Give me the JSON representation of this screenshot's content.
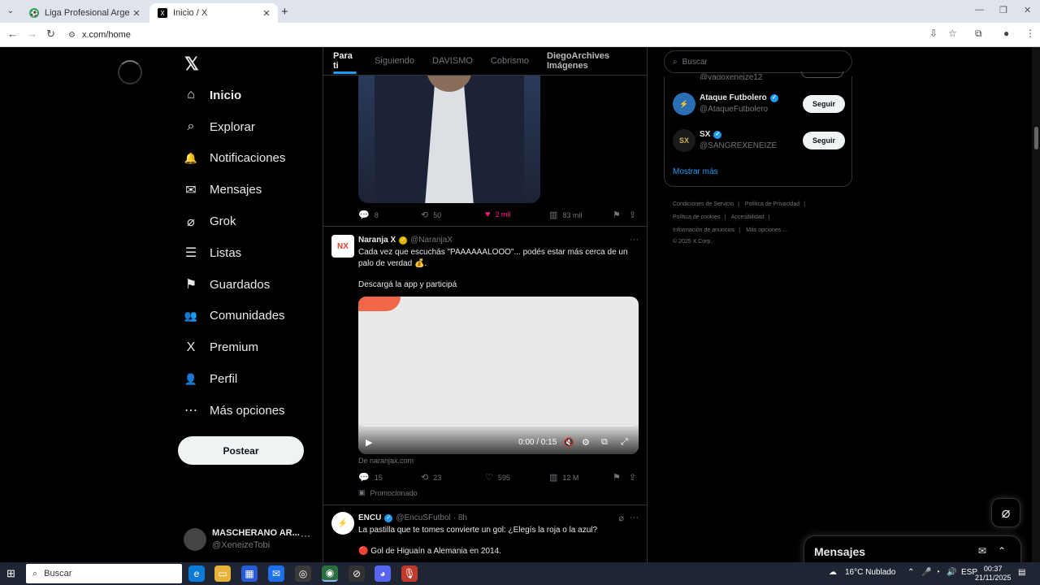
{
  "browser": {
    "tabs": [
      {
        "title": "Liga Profesional Argentina - PO",
        "active": false
      },
      {
        "title": "Inicio / X",
        "active": true
      }
    ],
    "url": "x.com/home"
  },
  "sidebar": {
    "items": [
      {
        "label": "Inicio",
        "icon": "home-icon",
        "glyph": "⌂"
      },
      {
        "label": "Explorar",
        "icon": "search-icon",
        "glyph": "⌕"
      },
      {
        "label": "Notificaciones",
        "icon": "bell-icon",
        "glyph": "🔔"
      },
      {
        "label": "Mensajes",
        "icon": "mail-icon",
        "glyph": "✉"
      },
      {
        "label": "Grok",
        "icon": "grok-icon",
        "glyph": "⌀"
      },
      {
        "label": "Listas",
        "icon": "list-icon",
        "glyph": "☰"
      },
      {
        "label": "Guardados",
        "icon": "bookmark-icon",
        "glyph": "⚑"
      },
      {
        "label": "Comunidades",
        "icon": "people-icon",
        "glyph": "👥"
      },
      {
        "label": "Premium",
        "icon": "x-icon",
        "glyph": "X"
      },
      {
        "label": "Perfil",
        "icon": "person-icon",
        "glyph": "👤"
      },
      {
        "label": "Más opciones",
        "icon": "more-circle-icon",
        "glyph": "⋯"
      }
    ],
    "post_button": "Postear",
    "account": {
      "name": "MASCHERANO AR...",
      "handle": "@XeneizeTobi",
      "more": "···"
    }
  },
  "timeline": {
    "tabs": [
      "Para ti",
      "Siguiendo",
      "DAVISMO",
      "Cobrismo",
      "DiegoArchives Imágenes"
    ],
    "post1_actions": {
      "replies": "8",
      "reposts": "50",
      "likes": "2 mil",
      "views": "83 mil"
    },
    "post2": {
      "avatar": "NX",
      "name": "Naranja X",
      "handle": "@NaranjaX",
      "text": "Cada vez que escuchás \"PAAAAAALOOO\"... podés estar más cerca de un palo de verdad 💰.",
      "text2": "Descargá la app y participá",
      "video_time": "0:00 / 0:15",
      "source": "De naranjax.com",
      "actions": {
        "replies": "15",
        "reposts": "23",
        "likes": "595",
        "views": "12 M"
      },
      "promoted": "Promocionado"
    },
    "post3": {
      "name": "ENCU",
      "handle": "@EncuSFutbol",
      "time": "· 8h",
      "text": "La pastilla que te tomes convierte un gol: ¿Elegís la roja o la azul?",
      "text2": "🔴 Gol de Higuaín a Alemania en 2014."
    }
  },
  "right": {
    "search_placeholder": "Buscar",
    "partial_handle": "@vagoxeneize12",
    "who_to_follow": [
      {
        "name": "Ataque Futbolero",
        "handle": "@AtaqueFutbolero",
        "button": "Seguir",
        "avatar_color": "#2b6fb3"
      },
      {
        "name": "SX",
        "handle": "@SANGREXENEIZE",
        "button": "Seguir",
        "avatar_color": "#1a1a1a"
      }
    ],
    "show_more": "Mostrar más",
    "footer": [
      "Condiciones de Servicio",
      "Política de Privacidad",
      "Política de cookies",
      "Accesibilidad",
      "Información de anuncios",
      "Más opciones ...",
      "© 2025 X Corp."
    ],
    "messages_title": "Mensajes"
  },
  "taskbar": {
    "search": "Buscar",
    "weather": "16°C  Nublado",
    "lang": "ESP",
    "time": "00:37",
    "date": "21/11/2025"
  }
}
